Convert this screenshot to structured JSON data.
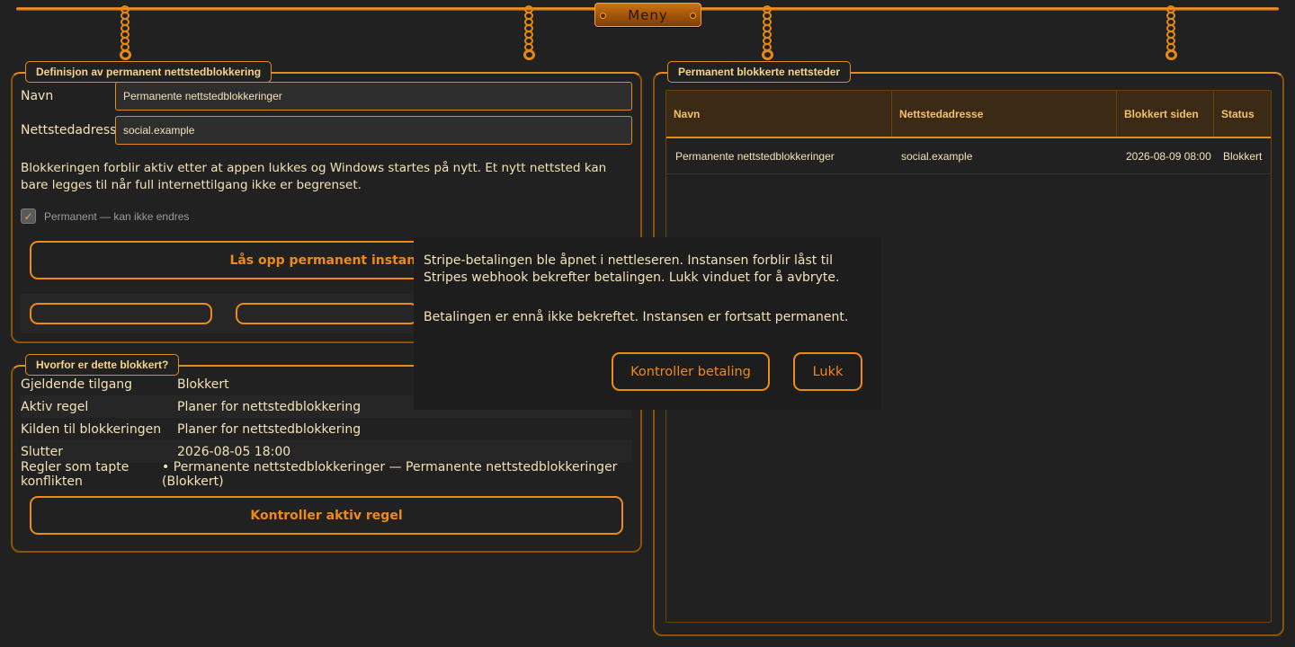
{
  "header": {
    "menu_label": "Meny"
  },
  "definition": {
    "legend": "Definisjon av permanent nettstedblokkering",
    "name_label": "Navn",
    "name_value": "Permanente nettstedblokkeringer",
    "address_label": "Nettstedadresse",
    "address_value": "social.example",
    "description": "Blokkeringen forblir aktiv etter at appen lukkes og Windows startes på nytt. Et nytt nettsted kan bare legges til når full internettilgang ikke er begrenset.",
    "permanent_checkbox_label": "Permanent — kan ikke endres",
    "permanent_checked": true,
    "unlock_button": "Lås opp permanent instans"
  },
  "why": {
    "legend": "Hvorfor er dette blokkert?",
    "rows": [
      {
        "key": "Gjeldende tilgang",
        "value": "Blokkert"
      },
      {
        "key": "Aktiv regel",
        "value": "Planer for nettstedblokkering"
      },
      {
        "key": "Kilden til blokkeringen",
        "value": "Planer for nettstedblokkering"
      },
      {
        "key": "Slutter",
        "value": "2026-08-05 18:00"
      },
      {
        "key": "Regler som tapte konflikten",
        "value": "• Permanente nettstedblokkeringer — Permanente nettstedblokkeringer (Blokkert)"
      }
    ],
    "check_rule_button": "Kontroller aktiv regel"
  },
  "blocked_sites": {
    "legend": "Permanent blokkerte nettsteder",
    "columns": [
      "Navn",
      "Nettstedadresse",
      "Blokkert siden",
      "Status"
    ],
    "rows": [
      {
        "name": "Permanente nettstedblokkeringer",
        "address": "social.example",
        "since": "2026-08-09 08:00",
        "status": "Blokkert"
      }
    ]
  },
  "dialog": {
    "message": "Stripe-betalingen ble åpnet i nettleseren. Instansen forblir låst til Stripes webhook bekrefter betalingen. Lukk vinduet for å avbryte.",
    "status": "Betalingen er ennå ikke bekreftet. Instansen er fortsatt permanent.",
    "check_payment_button": "Kontroller betaling",
    "close_button": "Lukk"
  },
  "icons": {
    "checkbox_mark": "checkmark-icon",
    "chain": "chain-icon"
  },
  "colors": {
    "accent": "#ee8b15",
    "background": "#212121",
    "text": "#f3e2b8"
  }
}
